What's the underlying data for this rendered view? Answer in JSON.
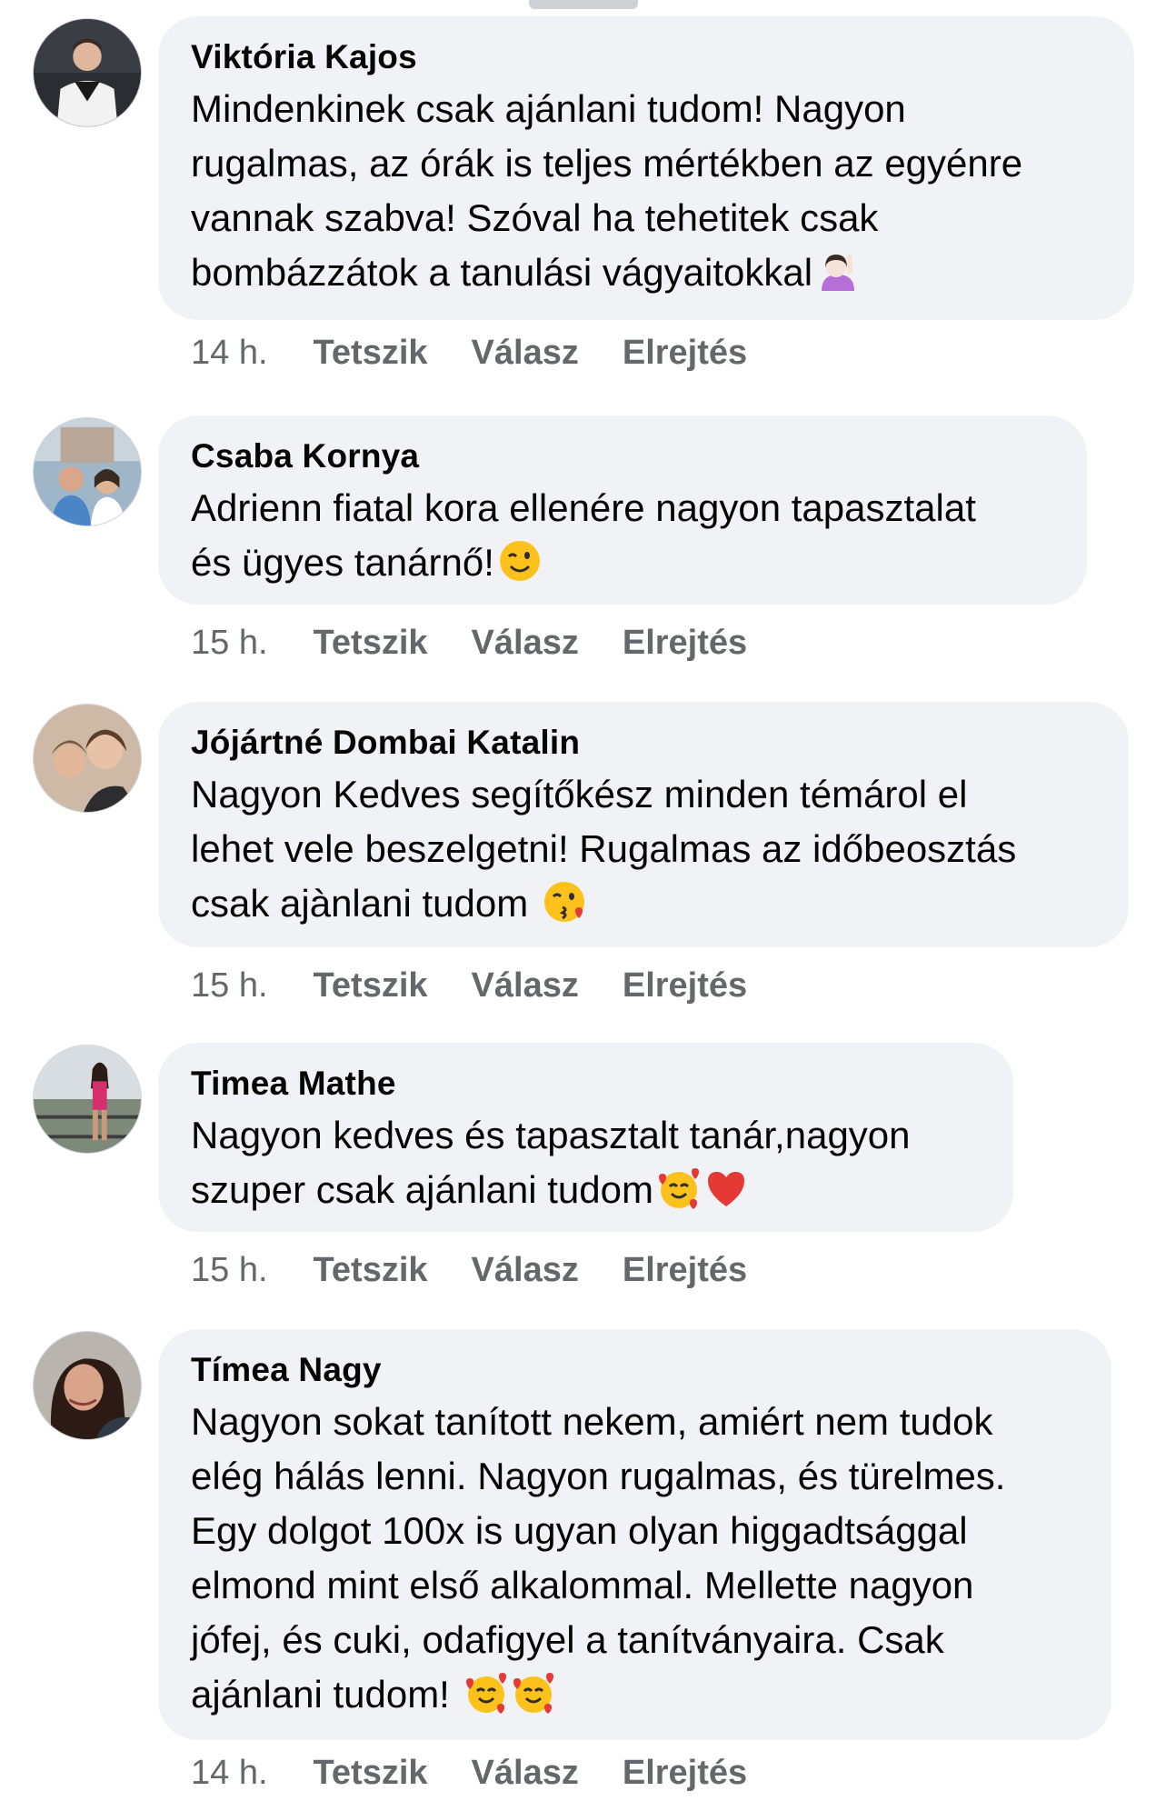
{
  "comments": [
    {
      "author": "Viktória Kajos",
      "text": "Mindenkinek csak ajánlani tudom! Nagyon\nrugalmas, az órák is teljes mértékben az egyénre\nvannak szabva! Szóval ha tehetitek csak\nbombázzátok a tanulási vágyaitokkal",
      "emoji": [
        "raising-hand-emoji"
      ],
      "time": "14 h.",
      "like": "Tetszik",
      "reply": "Válasz",
      "hide": "Elrejtés"
    },
    {
      "author": "Csaba Kornya",
      "text": "Adrienn fiatal kora ellenére nagyon tapasztalat\nés ügyes tanárnő!",
      "emoji": [
        "winking-face-emoji"
      ],
      "time": "15 h.",
      "like": "Tetszik",
      "reply": "Válasz",
      "hide": "Elrejtés"
    },
    {
      "author": "Jójártné Dombai Katalin",
      "text": "Nagyon Kedves segítőkész minden témárol el\nlehet vele beszelgetni! Rugalmas az időbeosztás\ncsak ajànlani tudom ",
      "emoji": [
        "kissing-face-emoji"
      ],
      "time": "15 h.",
      "like": "Tetszik",
      "reply": "Válasz",
      "hide": "Elrejtés"
    },
    {
      "author": "Timea Mathe",
      "text": "Nagyon kedves és tapasztalt tanár,nagyon\nszuper csak ajánlani tudom",
      "emoji": [
        "smiling-hearts-emoji",
        "red-heart-emoji"
      ],
      "time": "15 h.",
      "like": "Tetszik",
      "reply": "Válasz",
      "hide": "Elrejtés"
    },
    {
      "author": "Tímea Nagy",
      "text": "Nagyon sokat tanított nekem, amiért nem tudok\nelég hálás lenni. Nagyon rugalmas, és türelmes.\nEgy dolgot 100x is ugyan olyan higgadtsággal\nelmond mint első alkalommal. Mellette nagyon\njófej, és cuki, odafigyel a tanítványaira. Csak\najánlani tudom! ",
      "emoji": [
        "smiling-hearts-emoji",
        "smiling-hearts-emoji"
      ],
      "time": "14 h.",
      "like": "Tetszik",
      "reply": "Válasz",
      "hide": "Elrejtés"
    }
  ],
  "colors": {
    "bubble": "#f0f2f5",
    "meta_text": "#65676b",
    "body_text": "#050505"
  }
}
